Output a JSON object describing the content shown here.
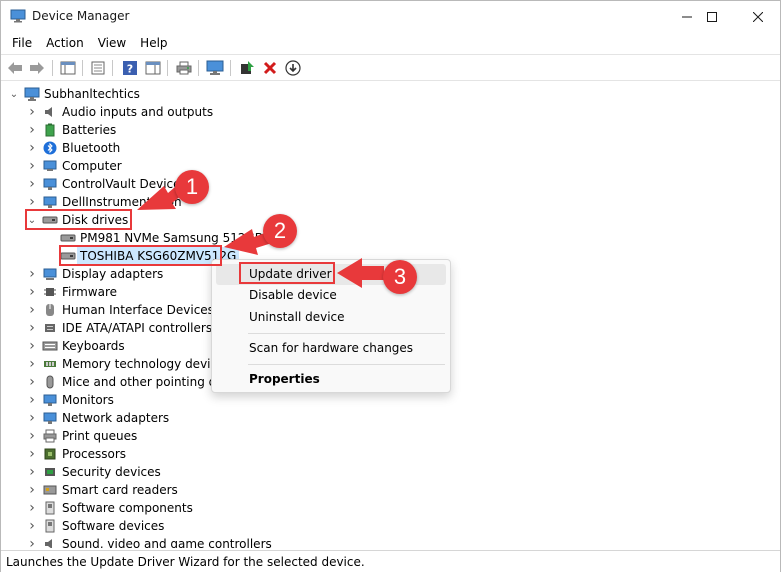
{
  "window": {
    "title": "Device Manager"
  },
  "menu": [
    {
      "label": "File"
    },
    {
      "label": "Action"
    },
    {
      "label": "View"
    },
    {
      "label": "Help"
    }
  ],
  "tree": {
    "root": "Subhanltechtics",
    "items": [
      {
        "label": "Audio inputs and outputs",
        "icon": "speaker-icon"
      },
      {
        "label": "Batteries",
        "icon": "battery-icon"
      },
      {
        "label": "Bluetooth",
        "icon": "bluetooth-icon"
      },
      {
        "label": "Computer",
        "icon": "computer-icon"
      },
      {
        "label": "ControlVault Device",
        "icon": "monitor-icon"
      },
      {
        "label": "DellInstrumentation",
        "icon": "monitor-icon"
      },
      {
        "label": "Disk drives",
        "icon": "disk-icon",
        "expanded": true
      },
      {
        "label": "PM981 NVMe Samsung 512GB",
        "icon": "disk-icon",
        "child": true
      },
      {
        "label": "TOSHIBA KSG60ZMV512G",
        "icon": "disk-icon",
        "child": true,
        "selected": true
      },
      {
        "label": "Display adapters",
        "icon": "display-icon"
      },
      {
        "label": "Firmware",
        "icon": "chip-icon"
      },
      {
        "label": "Human Interface Devices",
        "icon": "hid-icon"
      },
      {
        "label": "IDE ATA/ATAPI controllers",
        "icon": "ide-icon"
      },
      {
        "label": "Keyboards",
        "icon": "keyboard-icon"
      },
      {
        "label": "Memory technology devices",
        "icon": "memory-icon"
      },
      {
        "label": "Mice and other pointing devices",
        "icon": "mouse-icon"
      },
      {
        "label": "Monitors",
        "icon": "monitor-icon"
      },
      {
        "label": "Network adapters",
        "icon": "network-icon"
      },
      {
        "label": "Print queues",
        "icon": "printer-icon"
      },
      {
        "label": "Processors",
        "icon": "processor-icon"
      },
      {
        "label": "Security devices",
        "icon": "security-icon"
      },
      {
        "label": "Smart card readers",
        "icon": "smartcard-icon"
      },
      {
        "label": "Software components",
        "icon": "software-icon"
      },
      {
        "label": "Software devices",
        "icon": "software-icon"
      },
      {
        "label": "Sound, video and game controllers",
        "icon": "speaker-icon"
      }
    ]
  },
  "context_menu": {
    "items": [
      {
        "label": "Update driver"
      },
      {
        "label": "Disable device"
      },
      {
        "label": "Uninstall device"
      },
      {
        "label": "Scan for hardware changes"
      },
      {
        "label": "Properties"
      }
    ]
  },
  "annotations": {
    "badges": [
      "1",
      "2",
      "3"
    ],
    "color": "#e8393b"
  },
  "status": {
    "text": "Launches the Update Driver Wizard for the selected device."
  },
  "colors": {
    "selection": "#cce8ff",
    "annotation": "#e8393b"
  }
}
